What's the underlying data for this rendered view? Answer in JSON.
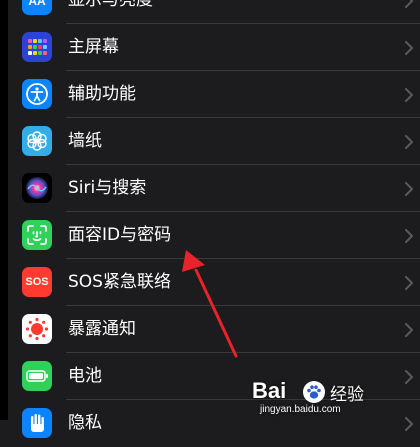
{
  "settings_list": [
    {
      "label": "显示与亮度",
      "icon": "display-brightness-icon",
      "color": "#0a84ff"
    },
    {
      "label": "主屏幕",
      "icon": "home-screen-icon",
      "color": "#2c44d6"
    },
    {
      "label": "辅助功能",
      "icon": "accessibility-icon",
      "color": "#0a84ff"
    },
    {
      "label": "墙纸",
      "icon": "wallpaper-icon",
      "color": "#32ade6"
    },
    {
      "label": "Siri与搜索",
      "icon": "siri-icon",
      "color": "#000000"
    },
    {
      "label": "面容ID与密码",
      "icon": "face-id-icon",
      "color": "#30d158"
    },
    {
      "label": "SOS紧急联络",
      "icon": "sos-icon",
      "color": "#ff3b30"
    },
    {
      "label": "暴露通知",
      "icon": "exposure-notification-icon",
      "color": "#ffffff"
    },
    {
      "label": "电池",
      "icon": "battery-icon",
      "color": "#30d158"
    },
    {
      "label": "隐私",
      "icon": "privacy-hand-icon",
      "color": "#0a84ff"
    }
  ],
  "sos_icon_text": "SOS",
  "watermark": {
    "brand": "Bai",
    "brand_cn": "经验",
    "url": "jingyan.baidu.com"
  },
  "colors": {
    "background": "#000000",
    "cell": "#1c1c1e",
    "separator": "#38383a",
    "chevron": "#5a5a5e",
    "annotation_arrow": "#e8232a"
  }
}
